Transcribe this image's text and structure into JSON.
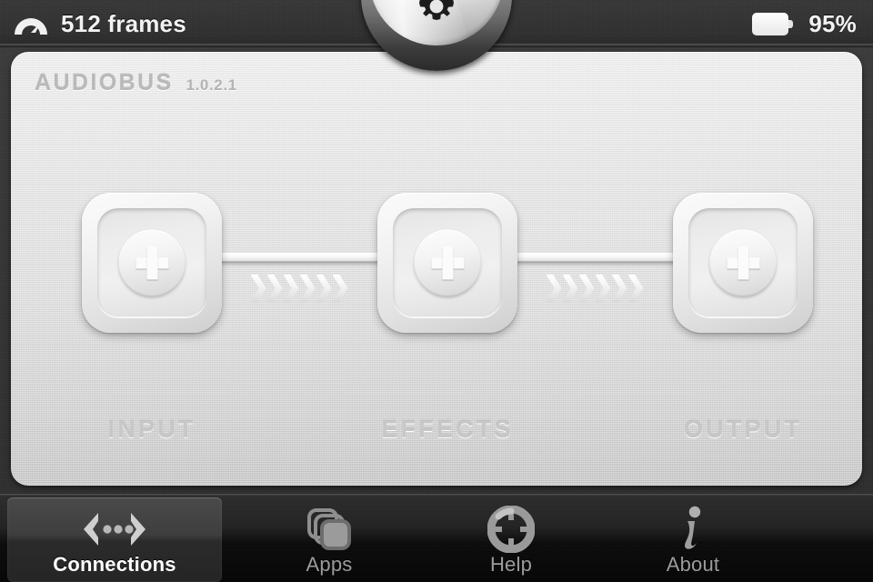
{
  "status_bar": {
    "frames_icon": "gauge-icon",
    "frames_label": "512 frames",
    "battery_icon": "battery-icon",
    "battery_label": "95%"
  },
  "settings_tab": {
    "icon": "gear-icon",
    "name": "settings-button"
  },
  "panel": {
    "brand_name": "AUDIOBUS",
    "version": "1.0.2.1"
  },
  "rack": {
    "slots": [
      {
        "id": "input",
        "label": "INPUT",
        "add_icon": "plus-icon"
      },
      {
        "id": "effects",
        "label": "EFFECTS",
        "add_icon": "plus-icon"
      },
      {
        "id": "output",
        "label": "OUTPUT",
        "add_icon": "plus-icon"
      }
    ],
    "connectors": [
      {
        "from": "input",
        "to": "effects",
        "arrow_count": 6
      },
      {
        "from": "effects",
        "to": "output",
        "arrow_count": 6
      }
    ]
  },
  "tab_bar": {
    "selected": "connections",
    "tabs": [
      {
        "id": "connections",
        "label": "Connections",
        "icon": "connections-icon",
        "selected": true
      },
      {
        "id": "apps",
        "label": "Apps",
        "icon": "apps-stack-icon",
        "selected": false
      },
      {
        "id": "help",
        "label": "Help",
        "icon": "life-ring-icon",
        "selected": false
      },
      {
        "id": "about",
        "label": "About",
        "icon": "info-i-icon",
        "selected": false
      }
    ]
  },
  "colors": {
    "panel_light": "#eeeeee",
    "panel_dark": "#c2c2c2",
    "background": "#343434",
    "tabbar_dark": "#060606",
    "selected_tab": "#4a4a4a",
    "label_gray": "#c7c7c7",
    "status_text": "#f2f2f2"
  }
}
